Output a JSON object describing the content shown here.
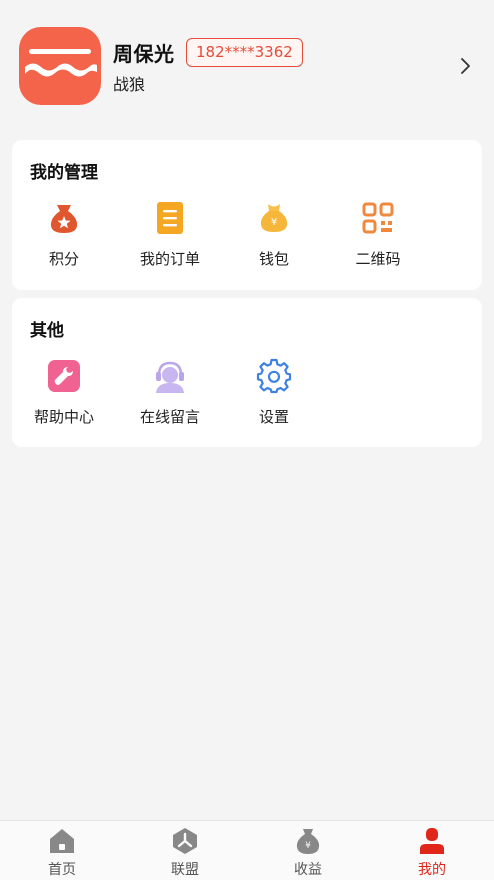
{
  "profile": {
    "name": "周保光",
    "phone": "182****3362",
    "nickname": "战狼"
  },
  "management": {
    "title": "我的管理",
    "items": [
      {
        "label": "积分",
        "icon": "points-bag-icon"
      },
      {
        "label": "我的订单",
        "icon": "order-list-icon"
      },
      {
        "label": "钱包",
        "icon": "wallet-icon"
      },
      {
        "label": "二维码",
        "icon": "qrcode-icon"
      }
    ]
  },
  "other": {
    "title": "其他",
    "items": [
      {
        "label": "帮助中心",
        "icon": "wrench-icon"
      },
      {
        "label": "在线留言",
        "icon": "headset-icon"
      },
      {
        "label": "设置",
        "icon": "gear-icon"
      }
    ]
  },
  "tabbar": {
    "items": [
      {
        "label": "首页",
        "icon": "home-icon"
      },
      {
        "label": "联盟",
        "icon": "alliance-icon"
      },
      {
        "label": "收益",
        "icon": "money-bag-icon"
      },
      {
        "label": "我的",
        "icon": "user-icon"
      }
    ],
    "active_index": 3
  },
  "colors": {
    "brand_red": "#e44d3a",
    "avatar_orange": "#f4644a",
    "order_yellow": "#f5a623",
    "wallet_gold": "#f5b63a",
    "qr_orange": "#f0883e",
    "help_pink": "#f06292",
    "headset_purple": "#b9a6e8",
    "settings_blue": "#3d82e0",
    "tab_active": "#e0261a",
    "tab_inactive": "#888888"
  }
}
